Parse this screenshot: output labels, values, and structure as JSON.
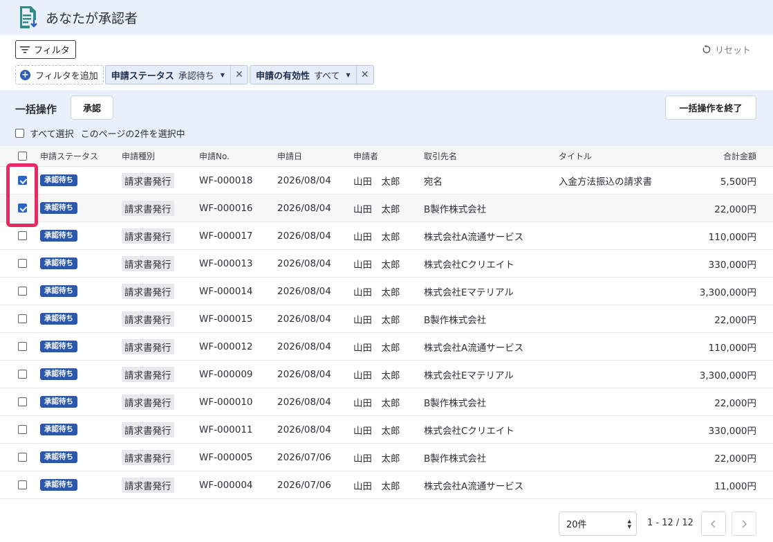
{
  "header": {
    "title": "あなたが承認者",
    "icon": "document-download-icon"
  },
  "filters": {
    "filter_button_label": "フィルタ",
    "reset_label": "リセット",
    "add_filter_label": "フィルタを追加",
    "chips": [
      {
        "key": "申請ステータス",
        "value": "承認待ち"
      },
      {
        "key": "申請の有効性",
        "value": "すべて"
      }
    ]
  },
  "bulk": {
    "label": "一括操作",
    "approve_label": "承認",
    "end_label": "一括操作を終了",
    "select_all_label": "すべて選択",
    "selection_info": "このページの2件を選択中"
  },
  "table": {
    "columns": [
      "申請ステータス",
      "申請種別",
      "申請No.",
      "申請日",
      "申請者",
      "取引先名",
      "タイトル",
      "合計金額"
    ],
    "rows": [
      {
        "checked": true,
        "status": "承認待ち",
        "type": "請求書発行",
        "no": "WF-000018",
        "date": "2026/08/04",
        "user": "山田　太郎",
        "partner": "宛名",
        "title": "入金方法振込の請求書",
        "amount": "5,500円"
      },
      {
        "checked": true,
        "status": "承認待ち",
        "type": "請求書発行",
        "no": "WF-000016",
        "date": "2026/08/04",
        "user": "山田　太郎",
        "partner": "B製作株式会社",
        "title": "",
        "amount": "22,000円"
      },
      {
        "checked": false,
        "status": "承認待ち",
        "type": "請求書発行",
        "no": "WF-000017",
        "date": "2026/08/04",
        "user": "山田　太郎",
        "partner": "株式会社A流通サービス",
        "title": "",
        "amount": "110,000円"
      },
      {
        "checked": false,
        "status": "承認待ち",
        "type": "請求書発行",
        "no": "WF-000013",
        "date": "2026/08/04",
        "user": "山田　太郎",
        "partner": "株式会社Cクリエイト",
        "title": "",
        "amount": "330,000円"
      },
      {
        "checked": false,
        "status": "承認待ち",
        "type": "請求書発行",
        "no": "WF-000014",
        "date": "2026/08/04",
        "user": "山田　太郎",
        "partner": "株式会社Eマテリアル",
        "title": "",
        "amount": "3,300,000円"
      },
      {
        "checked": false,
        "status": "承認待ち",
        "type": "請求書発行",
        "no": "WF-000015",
        "date": "2026/08/04",
        "user": "山田　太郎",
        "partner": "B製作株式会社",
        "title": "",
        "amount": "22,000円"
      },
      {
        "checked": false,
        "status": "承認待ち",
        "type": "請求書発行",
        "no": "WF-000012",
        "date": "2026/08/04",
        "user": "山田　太郎",
        "partner": "株式会社A流通サービス",
        "title": "",
        "amount": "110,000円"
      },
      {
        "checked": false,
        "status": "承認待ち",
        "type": "請求書発行",
        "no": "WF-000009",
        "date": "2026/08/04",
        "user": "山田　太郎",
        "partner": "株式会社Eマテリアル",
        "title": "",
        "amount": "3,300,000円"
      },
      {
        "checked": false,
        "status": "承認待ち",
        "type": "請求書発行",
        "no": "WF-000010",
        "date": "2026/08/04",
        "user": "山田　太郎",
        "partner": "B製作株式会社",
        "title": "",
        "amount": "22,000円"
      },
      {
        "checked": false,
        "status": "承認待ち",
        "type": "請求書発行",
        "no": "WF-000011",
        "date": "2026/08/04",
        "user": "山田　太郎",
        "partner": "株式会社Cクリエイト",
        "title": "",
        "amount": "330,000円"
      },
      {
        "checked": false,
        "status": "承認待ち",
        "type": "請求書発行",
        "no": "WF-000005",
        "date": "2026/07/06",
        "user": "山田　太郎",
        "partner": "B製作株式会社",
        "title": "",
        "amount": "22,000円"
      },
      {
        "checked": false,
        "status": "承認待ち",
        "type": "請求書発行",
        "no": "WF-000004",
        "date": "2026/07/06",
        "user": "山田　太郎",
        "partner": "株式会社A流通サービス",
        "title": "",
        "amount": "11,000円"
      }
    ]
  },
  "pagination": {
    "per_page": "20件",
    "range": "1 - 12 / 12",
    "prev_icon": "chevron-left-icon",
    "next_icon": "chevron-right-icon"
  },
  "colors": {
    "header_bg": "#e9f0fb",
    "badge": "#2b58ad",
    "checkbox_checked": "#2c64c6",
    "highlight": "#e52a64"
  }
}
